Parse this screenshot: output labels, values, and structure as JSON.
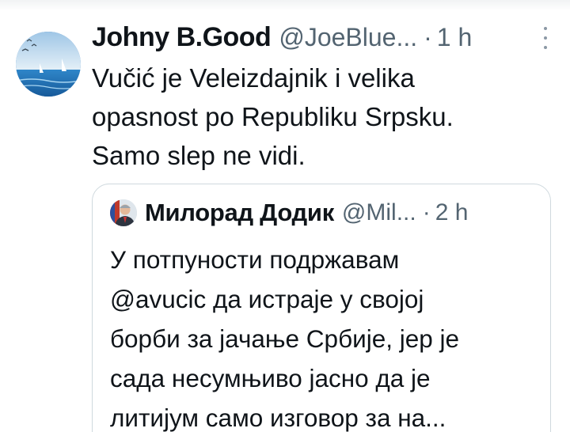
{
  "tweet": {
    "author_name": "Johny B.Good",
    "author_handle": "@JoeBlue...",
    "separator": "·",
    "time": "1 h",
    "text_lines": [
      "Vučić je Veleizdajnik i velika",
      "opasnost po Republiku Srpsku.",
      "Samo slep ne vidi."
    ]
  },
  "quoted_tweet": {
    "author_name": "Милорад Додик",
    "author_handle": "@Mil...",
    "separator": "·",
    "time": "2 h",
    "text_lines": [
      "У потпуности подржавам",
      "@avucic да истраје у својој",
      "борби за јачање Србије, јер је",
      "сада несумњиво јасно да је",
      "литијум само изговор за на..."
    ]
  },
  "icons": {
    "more": "more-vertical-icon"
  },
  "colors": {
    "text_primary": "#0f1419",
    "text_secondary": "#536471",
    "border": "#cfd9de"
  }
}
